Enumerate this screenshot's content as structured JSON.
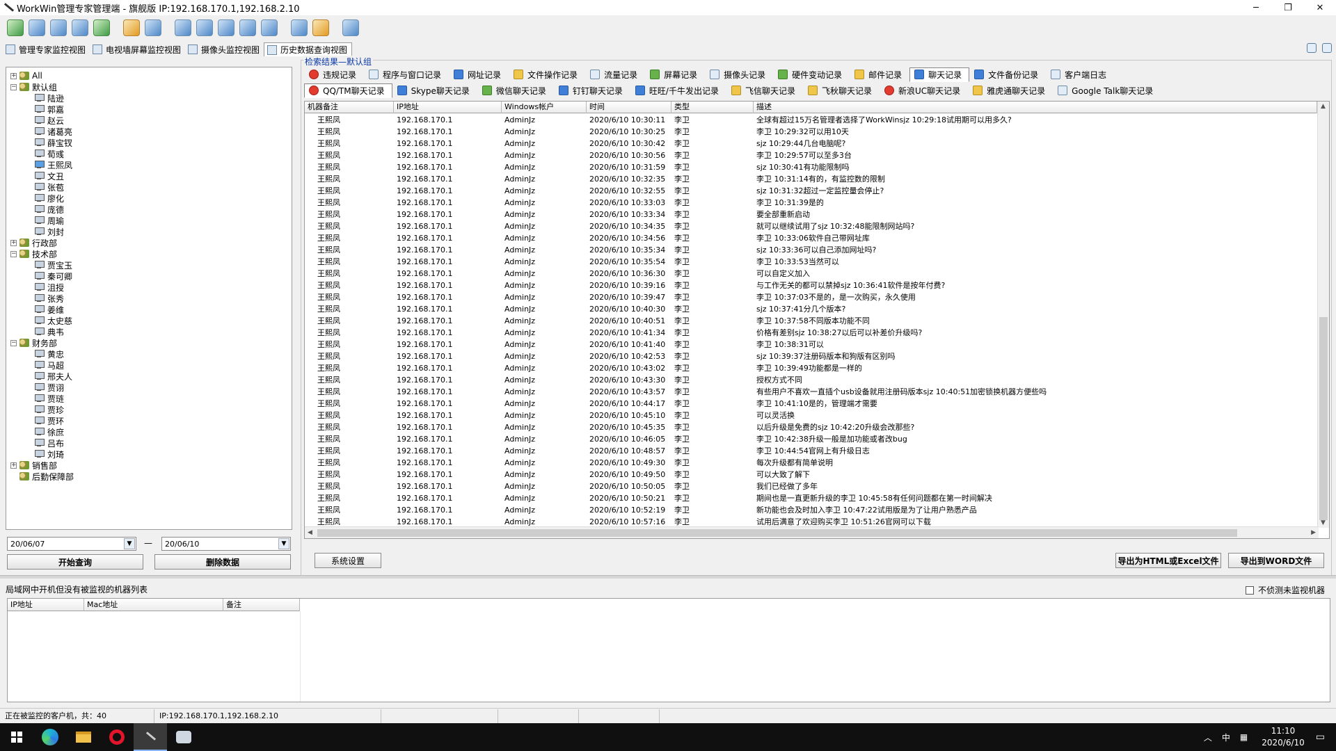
{
  "window": {
    "title": "WorkWin管理专家管理端 - 旗舰版 IP:192.168.170.1,192.168.2.10",
    "min": "─",
    "max": "❐",
    "close": "✕"
  },
  "view_tabs": [
    "管理专家监控视图",
    "电视墙屏幕监控视图",
    "摄像头监控视图",
    "历史数据查询视图"
  ],
  "tree": [
    {
      "label": "All",
      "level": 0,
      "exp": "+",
      "icon": "folder"
    },
    {
      "label": "默认组",
      "level": 0,
      "exp": "−",
      "icon": "folder"
    },
    {
      "label": "陆逊",
      "level": 1,
      "icon": "pc"
    },
    {
      "label": "郭嘉",
      "level": 1,
      "icon": "pc"
    },
    {
      "label": "赵云",
      "level": 1,
      "icon": "pc"
    },
    {
      "label": "诸葛亮",
      "level": 1,
      "icon": "pc"
    },
    {
      "label": "薛宝钗",
      "level": 1,
      "icon": "pc"
    },
    {
      "label": "荀彧",
      "level": 1,
      "icon": "pc"
    },
    {
      "label": "王熙凤",
      "level": 1,
      "icon": "pc-on"
    },
    {
      "label": "文丑",
      "level": 1,
      "icon": "pc"
    },
    {
      "label": "张苞",
      "level": 1,
      "icon": "pc"
    },
    {
      "label": "廖化",
      "level": 1,
      "icon": "pc"
    },
    {
      "label": "庞德",
      "level": 1,
      "icon": "pc"
    },
    {
      "label": "周瑜",
      "level": 1,
      "icon": "pc"
    },
    {
      "label": "刘封",
      "level": 1,
      "icon": "pc"
    },
    {
      "label": "行政部",
      "level": 0,
      "exp": "+",
      "icon": "folder"
    },
    {
      "label": "技术部",
      "level": 0,
      "exp": "−",
      "icon": "folder"
    },
    {
      "label": "贾宝玉",
      "level": 1,
      "icon": "pc"
    },
    {
      "label": "秦可卿",
      "level": 1,
      "icon": "pc"
    },
    {
      "label": "沮授",
      "level": 1,
      "icon": "pc"
    },
    {
      "label": "张秀",
      "level": 1,
      "icon": "pc"
    },
    {
      "label": "姜维",
      "level": 1,
      "icon": "pc"
    },
    {
      "label": "太史慈",
      "level": 1,
      "icon": "pc"
    },
    {
      "label": "典韦",
      "level": 1,
      "icon": "pc"
    },
    {
      "label": "财务部",
      "level": 0,
      "exp": "−",
      "icon": "folder"
    },
    {
      "label": "黄忠",
      "level": 1,
      "icon": "pc"
    },
    {
      "label": "马超",
      "level": 1,
      "icon": "pc"
    },
    {
      "label": "邢夫人",
      "level": 1,
      "icon": "pc"
    },
    {
      "label": "贾诩",
      "level": 1,
      "icon": "pc"
    },
    {
      "label": "贾琏",
      "level": 1,
      "icon": "pc"
    },
    {
      "label": "贾珍",
      "level": 1,
      "icon": "pc"
    },
    {
      "label": "贾环",
      "level": 1,
      "icon": "pc"
    },
    {
      "label": "徐庶",
      "level": 1,
      "icon": "pc"
    },
    {
      "label": "吕布",
      "level": 1,
      "icon": "pc"
    },
    {
      "label": "刘琦",
      "level": 1,
      "icon": "pc"
    },
    {
      "label": "销售部",
      "level": 0,
      "exp": "+",
      "icon": "folder"
    },
    {
      "label": "后勤保障部",
      "level": 0,
      "icon": "folder"
    }
  ],
  "date_from": "20/06/07",
  "date_to": "20/06/10",
  "date_dash": "—",
  "btn_query": "开始查询",
  "btn_delete": "删除数据",
  "group_label": "检索结果—默认组",
  "tabs_row1": [
    {
      "label": "违规记录",
      "ico": "red"
    },
    {
      "label": "程序与窗口记录",
      "ico": ""
    },
    {
      "label": "网址记录",
      "ico": "blue"
    },
    {
      "label": "文件操作记录",
      "ico": "yel"
    },
    {
      "label": "流量记录",
      "ico": ""
    },
    {
      "label": "屏幕记录",
      "ico": "grn"
    },
    {
      "label": "摄像头记录",
      "ico": ""
    },
    {
      "label": "硬件变动记录",
      "ico": "grn"
    },
    {
      "label": "邮件记录",
      "ico": "yel"
    },
    {
      "label": "聊天记录",
      "ico": "blue",
      "active": true
    },
    {
      "label": "文件备份记录",
      "ico": "blue"
    },
    {
      "label": "客户端日志",
      "ico": ""
    }
  ],
  "tabs_row2": [
    {
      "label": "QQ/TM聊天记录",
      "ico": "red",
      "active": true
    },
    {
      "label": "Skype聊天记录",
      "ico": "blue"
    },
    {
      "label": "微信聊天记录",
      "ico": "grn"
    },
    {
      "label": "钉钉聊天记录",
      "ico": "blue"
    },
    {
      "label": "旺旺/千牛发出记录",
      "ico": "blue"
    },
    {
      "label": "飞信聊天记录",
      "ico": "yel"
    },
    {
      "label": "飞秋聊天记录",
      "ico": "yel"
    },
    {
      "label": "新浪UC聊天记录",
      "ico": "red"
    },
    {
      "label": "雅虎通聊天记录",
      "ico": "yel"
    },
    {
      "label": "Google Talk聊天记录",
      "ico": ""
    }
  ],
  "columns": [
    "机器备注",
    "IP地址",
    "Windows帐户",
    "时间",
    "类型",
    "描述"
  ],
  "rows": [
    [
      "王熙凤",
      "192.168.170.1",
      "AdminJz",
      "2020/6/10 10:30:11",
      "李卫",
      "全球有超过15万名管理者选择了WorkWinsjz  10:29:18试用期可以用多久?"
    ],
    [
      "王熙凤",
      "192.168.170.1",
      "AdminJz",
      "2020/6/10 10:30:25",
      "李卫",
      "李卫  10:29:32可以用10天"
    ],
    [
      "王熙凤",
      "192.168.170.1",
      "AdminJz",
      "2020/6/10 10:30:42",
      "李卫",
      "sjz  10:29:44几台电脑呢?"
    ],
    [
      "王熙凤",
      "192.168.170.1",
      "AdminJz",
      "2020/6/10 10:30:56",
      "李卫",
      "李卫  10:29:57可以至多3台"
    ],
    [
      "王熙凤",
      "192.168.170.1",
      "AdminJz",
      "2020/6/10 10:31:59",
      "李卫",
      "sjz  10:30:41有功能限制吗"
    ],
    [
      "王熙凤",
      "192.168.170.1",
      "AdminJz",
      "2020/6/10 10:32:35",
      "李卫",
      "李卫  10:31:14有的，有监控数的限制"
    ],
    [
      "王熙凤",
      "192.168.170.1",
      "AdminJz",
      "2020/6/10 10:32:55",
      "李卫",
      "sjz  10:31:32超过一定监控量会停止?"
    ],
    [
      "王熙凤",
      "192.168.170.1",
      "AdminJz",
      "2020/6/10 10:33:03",
      "李卫",
      "李卫  10:31:39是的"
    ],
    [
      "王熙凤",
      "192.168.170.1",
      "AdminJz",
      "2020/6/10 10:33:34",
      "李卫",
      "要全部重新启动"
    ],
    [
      "王熙凤",
      "192.168.170.1",
      "AdminJz",
      "2020/6/10 10:34:35",
      "李卫",
      "就可以继续试用了sjz  10:32:48能限制网站吗?"
    ],
    [
      "王熙凤",
      "192.168.170.1",
      "AdminJz",
      "2020/6/10 10:34:56",
      "李卫",
      "李卫  10:33:06软件自己带网址库"
    ],
    [
      "王熙凤",
      "192.168.170.1",
      "AdminJz",
      "2020/6/10 10:35:34",
      "李卫",
      "sjz  10:33:36可以自己添加网址吗?"
    ],
    [
      "王熙凤",
      "192.168.170.1",
      "AdminJz",
      "2020/6/10 10:35:54",
      "李卫",
      "李卫  10:33:53当然可以"
    ],
    [
      "王熙凤",
      "192.168.170.1",
      "AdminJz",
      "2020/6/10 10:36:30",
      "李卫",
      "可以自定义加入"
    ],
    [
      "王熙凤",
      "192.168.170.1",
      "AdminJz",
      "2020/6/10 10:39:16",
      "李卫",
      "与工作无关的都可以禁掉sjz  10:36:41软件是按年付费?"
    ],
    [
      "王熙凤",
      "192.168.170.1",
      "AdminJz",
      "2020/6/10 10:39:47",
      "李卫",
      "李卫  10:37:03不是的，是一次购买，永久使用"
    ],
    [
      "王熙凤",
      "192.168.170.1",
      "AdminJz",
      "2020/6/10 10:40:30",
      "李卫",
      "sjz  10:37:41分几个版本?"
    ],
    [
      "王熙凤",
      "192.168.170.1",
      "AdminJz",
      "2020/6/10 10:40:51",
      "李卫",
      "李卫  10:37:58不同版本功能不同"
    ],
    [
      "王熙凤",
      "192.168.170.1",
      "AdminJz",
      "2020/6/10 10:41:34",
      "李卫",
      "价格有差别sjz  10:38:27以后可以补差价升级吗?"
    ],
    [
      "王熙凤",
      "192.168.170.1",
      "AdminJz",
      "2020/6/10 10:41:40",
      "李卫",
      "李卫  10:38:31可以"
    ],
    [
      "王熙凤",
      "192.168.170.1",
      "AdminJz",
      "2020/6/10 10:42:53",
      "李卫",
      "sjz  10:39:37注册码版本和狗版有区别吗"
    ],
    [
      "王熙凤",
      "192.168.170.1",
      "AdminJz",
      "2020/6/10 10:43:02",
      "李卫",
      "李卫  10:39:49功能都是一样的"
    ],
    [
      "王熙凤",
      "192.168.170.1",
      "AdminJz",
      "2020/6/10 10:43:30",
      "李卫",
      "授权方式不同"
    ],
    [
      "王熙凤",
      "192.168.170.1",
      "AdminJz",
      "2020/6/10 10:43:57",
      "李卫",
      "有些用户不喜欢一直插个usb设备就用注册码版本sjz  10:40:51加密锁换机器方便些吗"
    ],
    [
      "王熙凤",
      "192.168.170.1",
      "AdminJz",
      "2020/6/10 10:44:17",
      "李卫",
      "李卫  10:41:10是的，管理端才需要"
    ],
    [
      "王熙凤",
      "192.168.170.1",
      "AdminJz",
      "2020/6/10 10:45:10",
      "李卫",
      "可以灵活换"
    ],
    [
      "王熙凤",
      "192.168.170.1",
      "AdminJz",
      "2020/6/10 10:45:35",
      "李卫",
      "以后升级是免费的sjz  10:42:20升级会改那些?"
    ],
    [
      "王熙凤",
      "192.168.170.1",
      "AdminJz",
      "2020/6/10 10:46:05",
      "李卫",
      "李卫  10:42:38升级一般是加功能或者改bug"
    ],
    [
      "王熙凤",
      "192.168.170.1",
      "AdminJz",
      "2020/6/10 10:48:57",
      "李卫",
      "李卫  10:44:54官网上有升级日志"
    ],
    [
      "王熙凤",
      "192.168.170.1",
      "AdminJz",
      "2020/6/10 10:49:30",
      "李卫",
      "每次升级都有简单说明"
    ],
    [
      "王熙凤",
      "192.168.170.1",
      "AdminJz",
      "2020/6/10 10:49:50",
      "李卫",
      "可以大致了解下"
    ],
    [
      "王熙凤",
      "192.168.170.1",
      "AdminJz",
      "2020/6/10 10:50:05",
      "李卫",
      "我们已经做了多年"
    ],
    [
      "王熙凤",
      "192.168.170.1",
      "AdminJz",
      "2020/6/10 10:50:21",
      "李卫",
      "期间也是一直更新升级的李卫  10:45:58有任何问题都在第一时间解决"
    ],
    [
      "王熙凤",
      "192.168.170.1",
      "AdminJz",
      "2020/6/10 10:52:19",
      "李卫",
      "新功能也会及时加入李卫  10:47:22试用版是为了让用户熟悉产品"
    ],
    [
      "王熙凤",
      "192.168.170.1",
      "AdminJz",
      "2020/6/10 10:57:16",
      "李卫",
      "试用后满意了欢迎购买李卫  10:51:26官网可以下载"
    ]
  ],
  "btn_settings": "系统设置",
  "btn_export_html": "导出为HTML或Excel文件",
  "btn_export_word": "导出到WORD文件",
  "bottom_title": "局域网中开机但没有被监视的机器列表",
  "checkbox_label": "不侦测未监视机器",
  "bottom_columns": [
    "IP地址",
    "Mac地址",
    "备注"
  ],
  "status": {
    "left": "正在被监控的客户机，共：40",
    "ip": "IP:192.168.170.1,192.168.2.10"
  },
  "taskbar": {
    "ime": "中",
    "time": "11:10",
    "date": "2020/6/10"
  }
}
